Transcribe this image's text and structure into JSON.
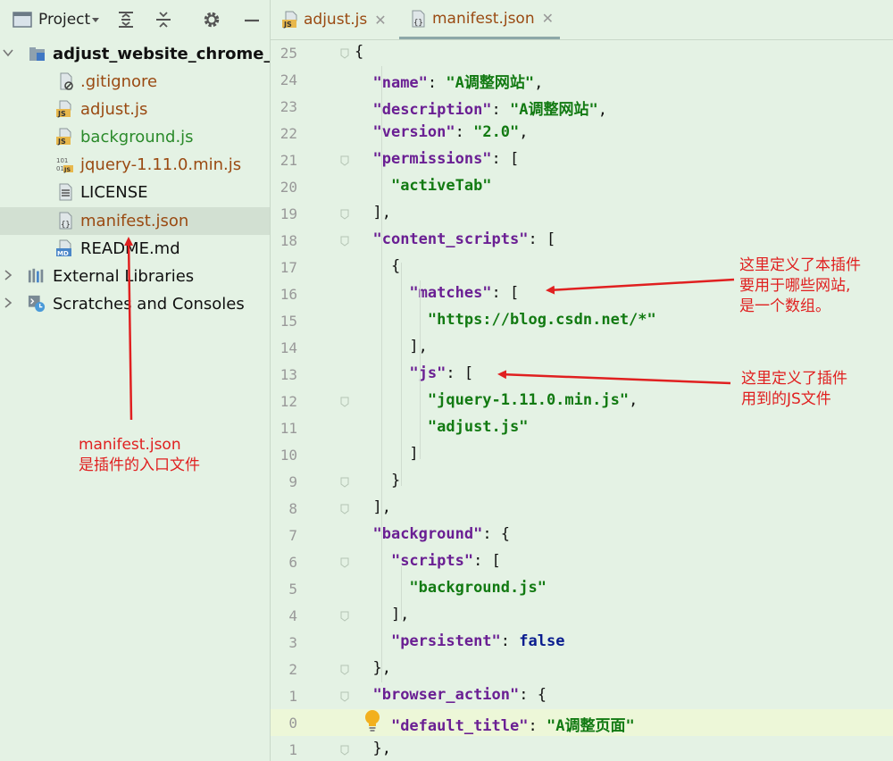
{
  "sidebar": {
    "title": "Project",
    "items": [
      {
        "label": "adjust_website_chrome_ext",
        "icon": "folder-icon",
        "color": "#111111",
        "bold": true
      },
      {
        "label": ".gitignore",
        "icon": "ignore-file-icon",
        "color": "#9a4a12"
      },
      {
        "label": "adjust.js",
        "icon": "js-file-icon",
        "color": "#9a4a12"
      },
      {
        "label": "background.js",
        "icon": "js-file-icon",
        "color": "#2a8a2a"
      },
      {
        "label": "jquery-1.11.0.min.js",
        "icon": "js-binary-file-icon",
        "color": "#9a4a12"
      },
      {
        "label": "LICENSE",
        "icon": "text-file-icon",
        "color": "#111111"
      },
      {
        "label": "manifest.json",
        "icon": "json-file-icon",
        "color": "#9a4a12",
        "selected": true
      },
      {
        "label": "README.md",
        "icon": "markdown-file-icon",
        "color": "#111111"
      },
      {
        "label": "External Libraries",
        "icon": "libraries-icon",
        "color": "#111111"
      },
      {
        "label": "Scratches and Consoles",
        "icon": "scratches-icon",
        "color": "#111111"
      }
    ]
  },
  "tabs": [
    {
      "label": "adjust.js",
      "icon": "js-file-icon"
    },
    {
      "label": "manifest.json",
      "icon": "json-file-icon",
      "active": true
    }
  ],
  "editor": {
    "line_numbers": [
      "25",
      "24",
      "23",
      "22",
      "21",
      "20",
      "19",
      "18",
      "17",
      "16",
      "15",
      "14",
      "13",
      "12",
      "11",
      "10",
      "9",
      "8",
      "7",
      "6",
      "5",
      "4",
      "3",
      "2",
      "1",
      "0",
      "1"
    ],
    "lines": [
      "{",
      "  \"name\": \"A调整网站\",",
      "  \"description\": \"A调整网站\",",
      "  \"version\": \"2.0\",",
      "  \"permissions\": [",
      "    \"activeTab\"",
      "  ],",
      "  \"content_scripts\": [",
      "    {",
      "      \"matches\": [",
      "        \"https://blog.csdn.net/*\"",
      "      ],",
      "      \"js\": [",
      "        \"jquery-1.11.0.min.js\",",
      "        \"adjust.js\"",
      "      ]",
      "    }",
      "  ],",
      "  \"background\": {",
      "    \"scripts\": [",
      "      \"background.js\"",
      "    ],",
      "    \"persistent\": false",
      "  },",
      "  \"browser_action\": {",
      "    \"default_title\": \"A调整页面\"",
      "  },"
    ]
  },
  "annotations": {
    "matches_note": "这里定义了本插件\n要用于哪些网站,\n是一个数组。",
    "js_note": "这里定义了插件\n用到的JS文件",
    "manifest_note": "manifest.json\n是插件的入口文件"
  },
  "colors": {
    "annotation": "#e02020",
    "selection": "#d2e0d2",
    "background": "#e4f2e4"
  }
}
